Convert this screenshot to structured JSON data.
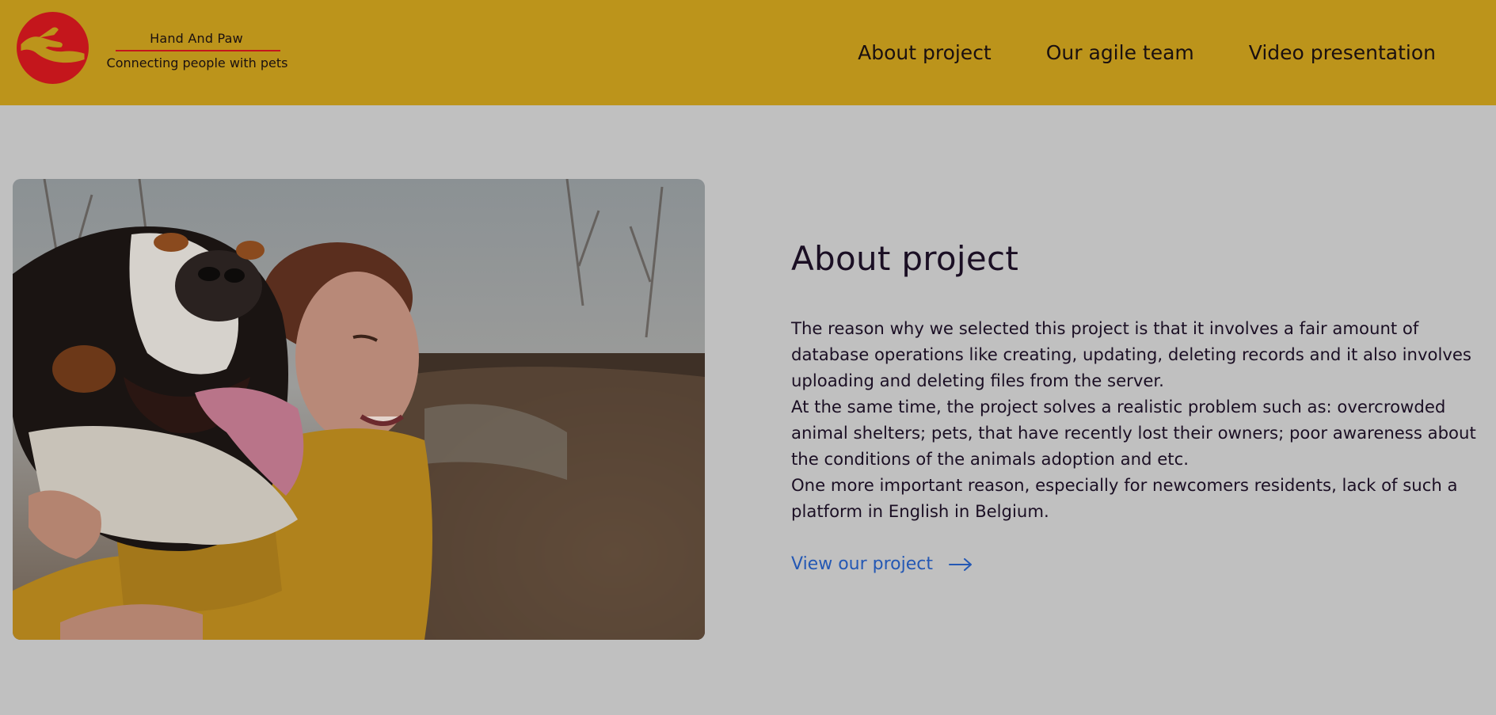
{
  "header": {
    "brand_title": "Hand And Paw",
    "brand_tagline": "Connecting people with pets",
    "logo_icon": "hand-and-paw-logo",
    "nav": [
      {
        "label": "About project"
      },
      {
        "label": "Our agile team"
      },
      {
        "label": "Video presentation"
      }
    ]
  },
  "main": {
    "image_icon": "woman-hugging-dog-photo",
    "title": "About project",
    "paragraphs": [
      "The reason why we selected this project is that it involves a fair amount of database operations like creating, updating, deleting records and it also involves uploading and deleting files from the server.",
      "At the same time, the project solves a realistic problem such as: overcrowded animal shelters; pets, that have recently lost their owners; poor awareness about the conditions of the animals adoption and etc.",
      "One more important reason, especially for newcomers residents, lack of such a platform in English in Belgium."
    ],
    "link_label": "View our project",
    "link_icon": "arrow-right-icon"
  },
  "colors": {
    "header_bg": "#bc941b",
    "page_bg": "#c0c0c0",
    "logo_red": "#c4161c",
    "link_blue": "#2458b4",
    "text_dark": "#1b0f24"
  }
}
